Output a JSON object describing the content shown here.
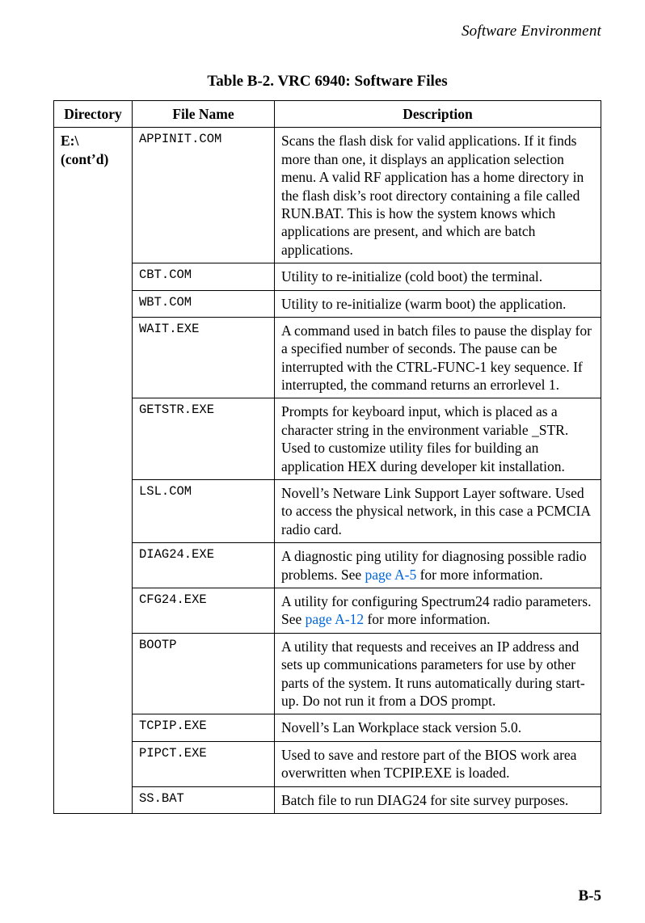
{
  "running_head": "Software Environment",
  "table_caption": "Table B-2. VRC 6940: Software Files",
  "columns": {
    "directory": "Directory",
    "file_name": "File Name",
    "description": "Description"
  },
  "directory_cell": "E:\\\n(cont’d)",
  "rows": [
    {
      "file": "APPINIT.COM",
      "desc": "Scans the flash disk for valid applications. If it finds more than one, it displays an application selection menu. A valid RF application has a home directory in the flash disk’s root directory containing a file called RUN.BAT. This is how the system knows which applications are present, and which are batch applications."
    },
    {
      "file": "CBT.COM",
      "desc": "Utility to re-initialize (cold boot) the terminal."
    },
    {
      "file": "WBT.COM",
      "desc": "Utility to re-initialize (warm boot) the application."
    },
    {
      "file": "WAIT.EXE",
      "desc": "A command used in batch files to pause the display for a specified number of seconds. The pause can be interrupted with the CTRL-FUNC-1 key sequence. If interrupted, the command returns an errorlevel 1."
    },
    {
      "file": "GETSTR.EXE",
      "desc": "Prompts for keyboard input, which is placed as a character string in the environment variable _STR. Used to customize utility files for building an application HEX during developer kit installation."
    },
    {
      "file": "LSL.COM",
      "desc": "Novell’s Netware Link Support Layer software. Used to access the physical network, in this case a PCMCIA radio card."
    },
    {
      "file": "DIAG24.EXE",
      "desc_pre": "A diagnostic ping utility for diagnosing possible radio problems. See ",
      "link": "page A-5",
      "desc_post": " for more information."
    },
    {
      "file": "CFG24.EXE",
      "desc_pre": "A utility for configuring Spectrum24 radio parameters. See ",
      "link": "page A-12",
      "desc_post": " for more information."
    },
    {
      "file": "BOOTP",
      "desc": "A utility that requests and receives an IP address and sets up communications parameters for use by other parts of the system. It runs automatically during start-up. Do not run it from a DOS prompt."
    },
    {
      "file": "TCPIP.EXE",
      "desc": "Novell’s Lan Workplace stack version 5.0."
    },
    {
      "file": "PIPCT.EXE",
      "desc": "Used to save and restore part of the BIOS work area overwritten when TCPIP.EXE is loaded."
    },
    {
      "file": "SS.BAT",
      "desc": "Batch file to run DIAG24 for site survey purposes."
    }
  ],
  "page_number": "B-5"
}
